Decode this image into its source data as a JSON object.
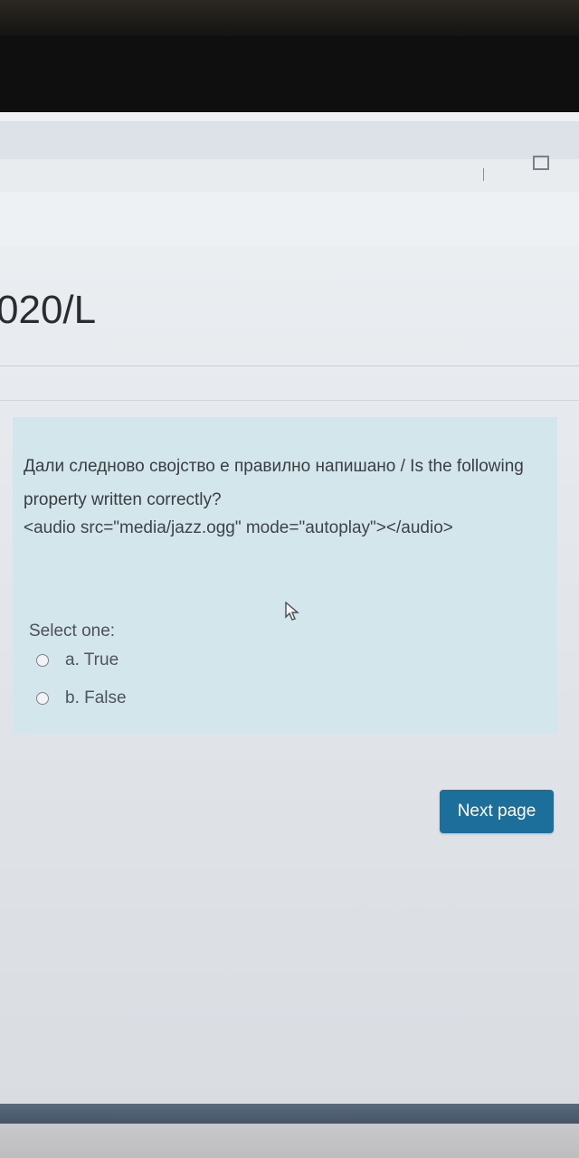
{
  "window": {
    "minimize_icon": "minimize-icon",
    "maximize_icon": "maximize-icon"
  },
  "header": {
    "course_code": "020/L"
  },
  "question": {
    "text": "Дали следново својство е правилно напишано / Is the following property written correctly?",
    "code": "<audio src=\"media/jazz.ogg\" mode=\"autoplay\"></audio>",
    "select_label": "Select one:",
    "options": [
      {
        "label": "a. True"
      },
      {
        "label": "b. False"
      }
    ]
  },
  "footer": {
    "next_button": "Next page"
  },
  "colors": {
    "question_bg": "#d3e6ec",
    "button_bg": "#1d6f9b",
    "taskbar": "#4d5d70"
  }
}
